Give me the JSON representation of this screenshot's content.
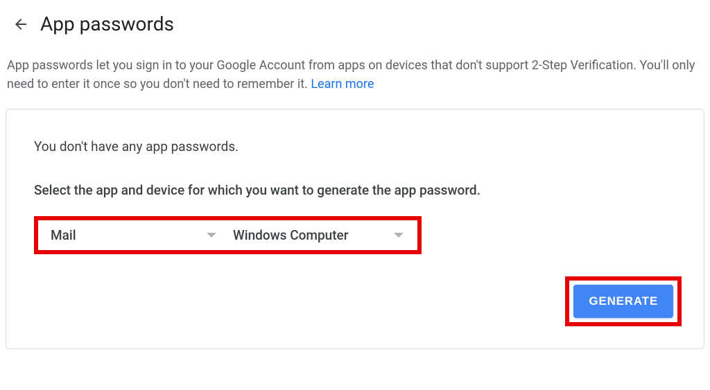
{
  "header": {
    "title": "App passwords"
  },
  "description": {
    "text": "App passwords let you sign in to your Google Account from apps on devices that don't support 2-Step Verification. You'll only need to enter it once so you don't need to remember it. ",
    "learn_more": "Learn more"
  },
  "card": {
    "status": "You don't have any app passwords.",
    "instruction": "Select the app and device for which you want to generate the app password."
  },
  "dropdowns": {
    "app": "Mail",
    "device": "Windows Computer"
  },
  "buttons": {
    "generate": "GENERATE"
  }
}
